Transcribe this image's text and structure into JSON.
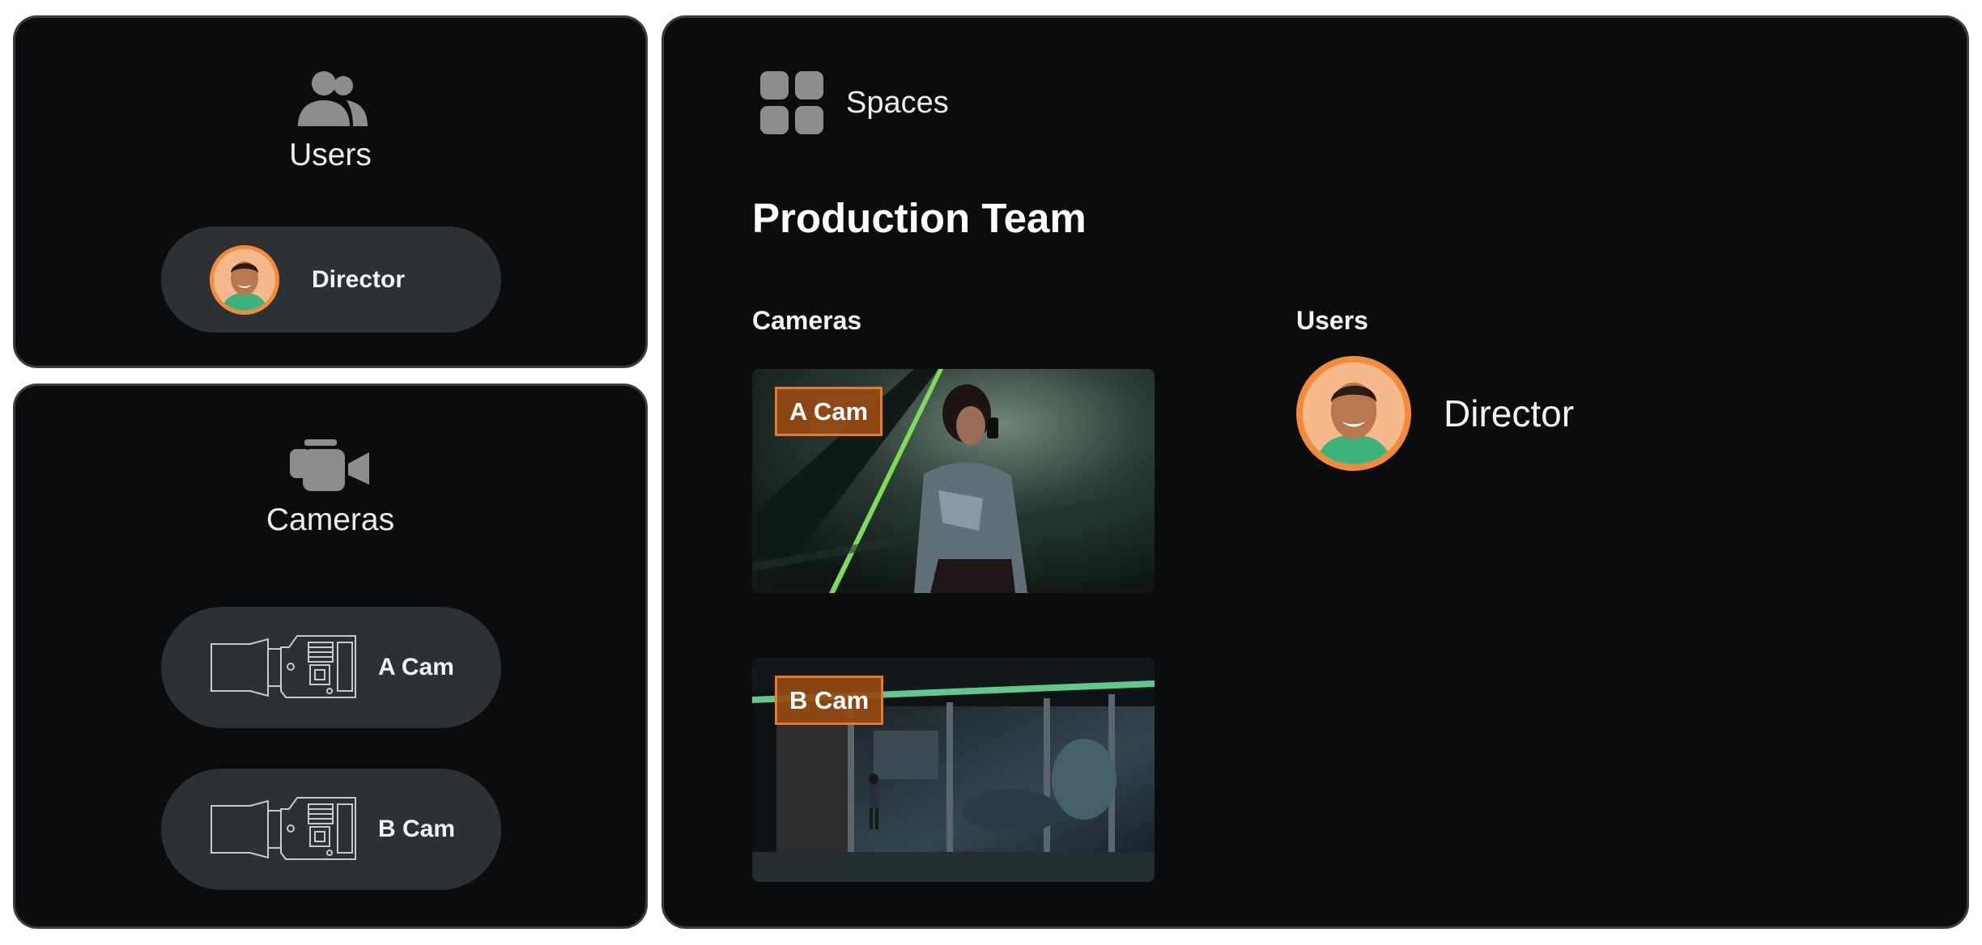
{
  "users_panel": {
    "title": "Users",
    "user": {
      "name": "Director"
    }
  },
  "cameras_panel": {
    "title": "Cameras",
    "items": [
      {
        "label": "A Cam"
      },
      {
        "label": "B Cam"
      }
    ]
  },
  "spaces_panel": {
    "title": "Spaces",
    "space_name": "Production Team",
    "cameras_label": "Cameras",
    "users_label": "Users",
    "cameras": [
      {
        "label": "A Cam"
      },
      {
        "label": "B Cam"
      }
    ],
    "users": [
      {
        "name": "Director"
      }
    ]
  },
  "colors": {
    "panel_bg": "#0b0c0e",
    "pill_bg": "#2c3136",
    "accent": "#f58a3a",
    "tag_bg": "#964a12"
  }
}
